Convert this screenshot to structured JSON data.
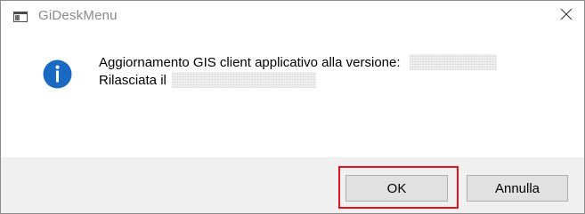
{
  "window": {
    "title": "GiDeskMenu",
    "app_icon": "window-app-icon",
    "close_icon": "close-icon"
  },
  "message": {
    "icon": "info-icon",
    "line1": "Aggiornamento GIS client applicativo alla versione:",
    "line2": "Rilasciata il"
  },
  "buttons": {
    "ok_label": "OK",
    "cancel_label": "Annulla"
  },
  "colors": {
    "info_blue": "#1a6ac4",
    "highlight_red": "#e0141e",
    "footer_bg": "#f0f0f0"
  }
}
